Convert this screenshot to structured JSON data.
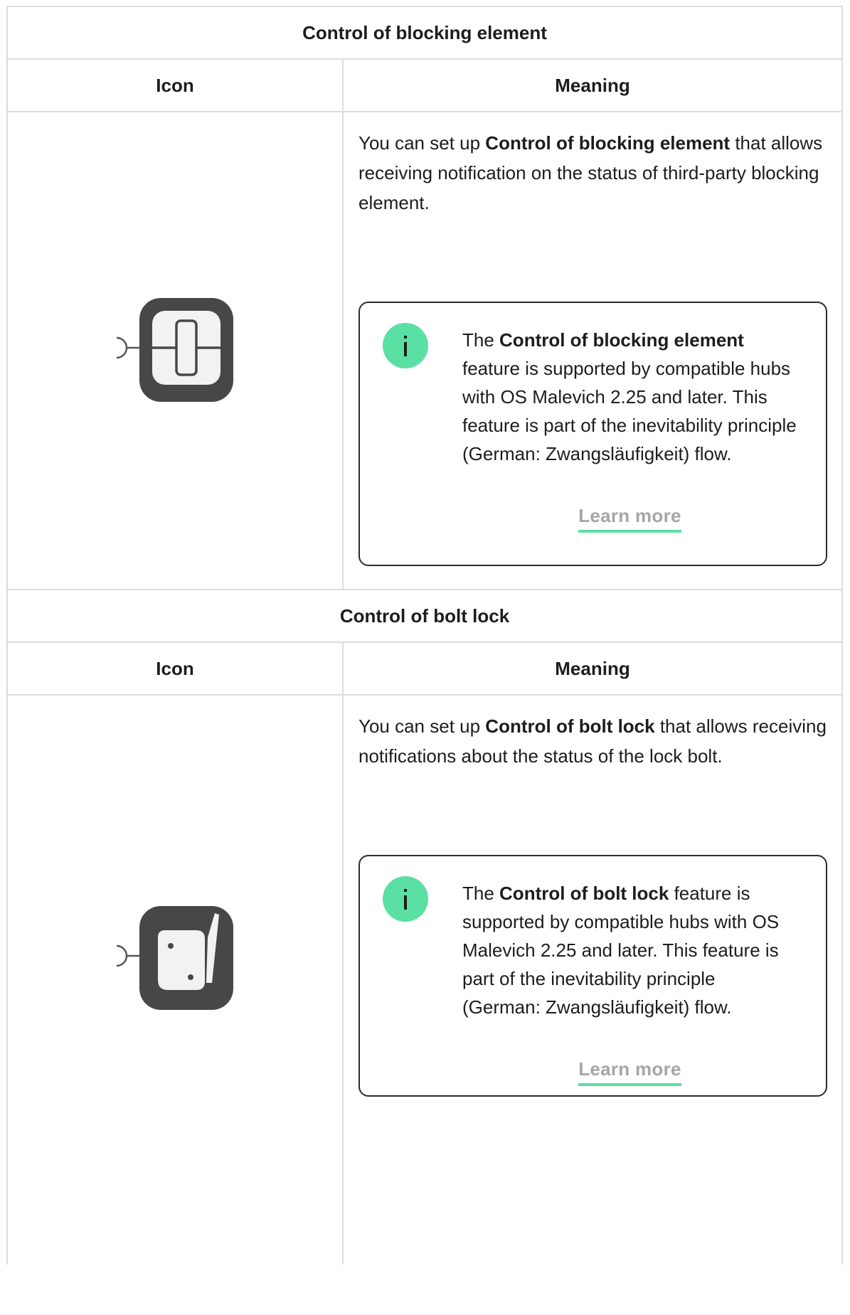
{
  "sections": [
    {
      "title": "Control of blocking element",
      "head_icon": "Icon",
      "head_meaning": "Meaning",
      "icon": "blocking-element-icon",
      "desc_pre": "You can set up ",
      "desc_bold": "Control of blocking element",
      "desc_post": " that allows receiving notification on the status of third-party blocking element.",
      "note_pre": "The ",
      "note_bold": "Control of blocking element",
      "note_post": " feature is supported by compatible hubs with OS Malevich 2.25 and later. This feature is part of the inevitability principle (German: Zwangsläufigkeit) flow.",
      "link": "Learn more"
    },
    {
      "title": "Control of bolt lock",
      "head_icon": "Icon",
      "head_meaning": "Meaning",
      "icon": "bolt-lock-icon",
      "desc_pre": "You can set up ",
      "desc_bold": "Control of bolt lock",
      "desc_post": " that allows receiving notifications about the status of the lock bolt.",
      "note_pre": "The ",
      "note_bold": "Control of bolt lock",
      "note_post": " feature is supported by compatible hubs with OS Malevich 2.25 and later. This feature is part of the inevitability principle (German: Zwangsläufigkeit) flow.",
      "link": "Learn more"
    }
  ],
  "colors": {
    "accent": "#5ae0a2",
    "border": "#dcdcdc",
    "icon_dark": "#474747",
    "link_gray": "#a6a6a6"
  }
}
